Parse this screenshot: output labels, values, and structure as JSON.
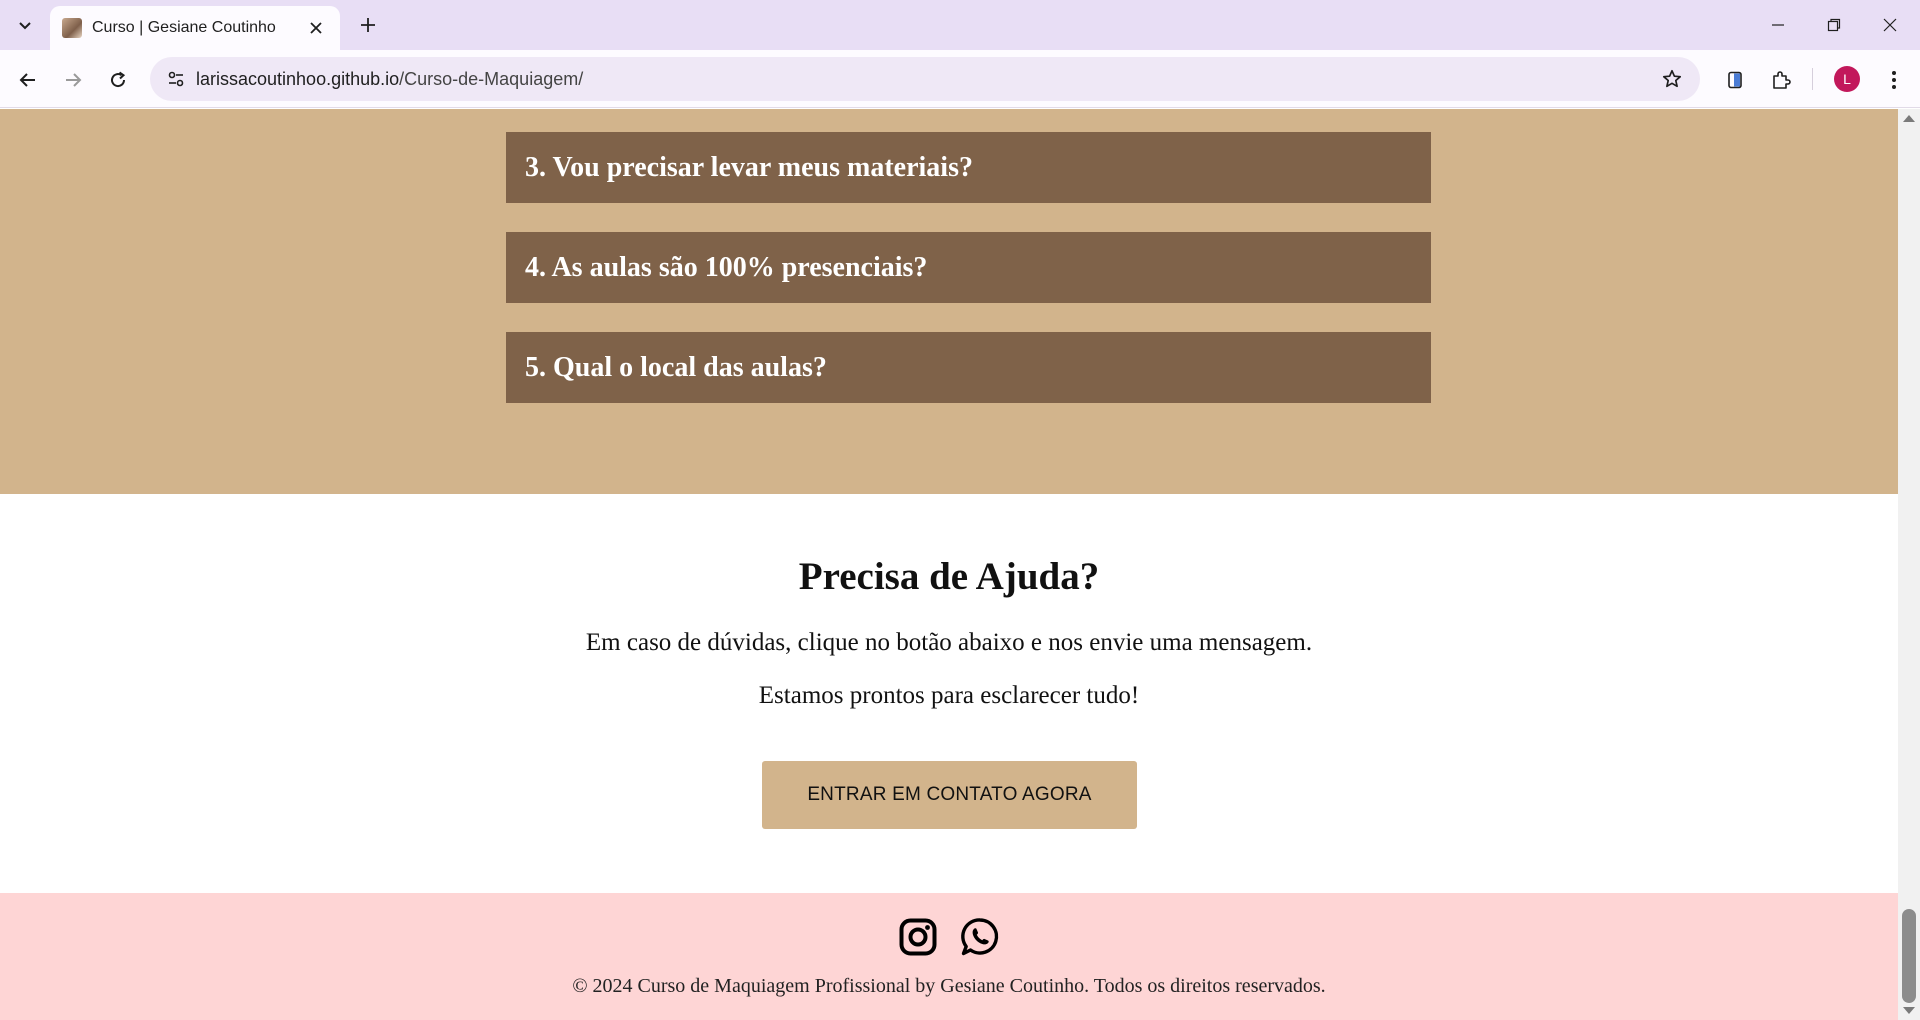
{
  "browser": {
    "tab_title": "Curso | Gesiane Coutinho",
    "url_domain": "larissacoutinhoo.github.io",
    "url_path": "/Curso-de-Maquiagem/",
    "profile_initial": "L"
  },
  "faq": {
    "items": [
      {
        "label": "3. Vou precisar levar meus materiais?"
      },
      {
        "label": "4. As aulas são 100% presenciais?"
      },
      {
        "label": "5. Qual o local das aulas?"
      }
    ]
  },
  "help": {
    "title": "Precisa de Ajuda?",
    "line1": "Em caso de dúvidas, clique no botão abaixo e nos envie uma mensagem.",
    "line2": "Estamos prontos para esclarecer tudo!",
    "button_label": "ENTRAR EM CONTATO AGORA"
  },
  "footer": {
    "social_icons": [
      "instagram-icon",
      "whatsapp-icon"
    ],
    "copyright": "© 2024 Curso de Maquiagem Profissional by Gesiane Coutinho. Todos os direitos reservados."
  },
  "colors": {
    "faq_background": "#d2b48c",
    "faq_item": "#7f6249",
    "button": "#d2b48c",
    "footer": "#fed5d5"
  }
}
